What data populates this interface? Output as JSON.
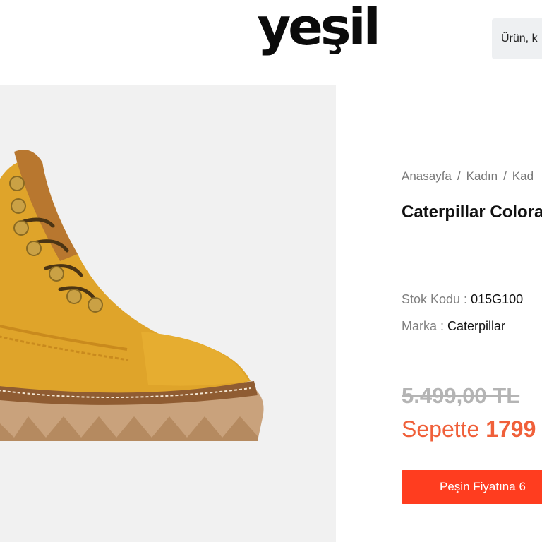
{
  "header": {
    "logo_text": "yeşil",
    "search_text": "Ürün, k"
  },
  "product_image": {
    "subject": "yellow leather boot icon"
  },
  "breadcrumb": {
    "items": [
      "Anasayfa",
      "Kadın",
      "Kad"
    ]
  },
  "product": {
    "title": "Caterpillar Colora",
    "sku_label": "Stok Kodu : ",
    "sku_value": "015G100",
    "brand_label": "Marka : ",
    "brand_value": "Caterpillar",
    "old_price": "5.499,00 TL",
    "basket_label": "Sepette ",
    "basket_amount": "1799",
    "cta_label": "Peşin Fiyatına 6"
  },
  "colors": {
    "accent": "#ff3d1f",
    "basket_price": "#f0603a",
    "old_price": "#b4b4b4"
  }
}
